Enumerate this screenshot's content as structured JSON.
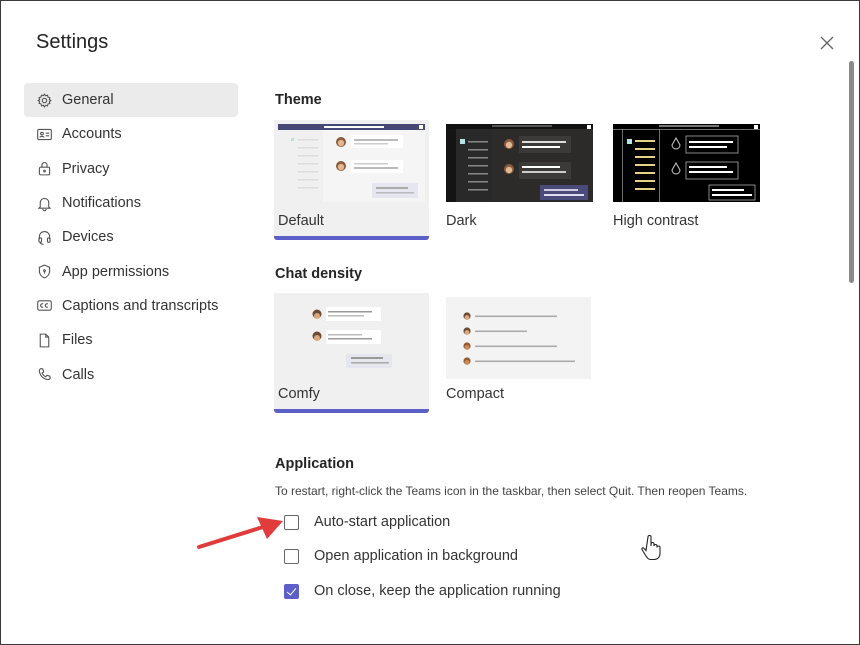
{
  "dialog": {
    "title": "Settings",
    "close_icon": "close-icon"
  },
  "sidebar": {
    "items": [
      {
        "label": "General",
        "icon": "gear-icon",
        "active": true
      },
      {
        "label": "Accounts",
        "icon": "contact-card-icon",
        "active": false
      },
      {
        "label": "Privacy",
        "icon": "lock-icon",
        "active": false
      },
      {
        "label": "Notifications",
        "icon": "bell-icon",
        "active": false
      },
      {
        "label": "Devices",
        "icon": "headset-icon",
        "active": false
      },
      {
        "label": "App permissions",
        "icon": "shield-icon",
        "active": false
      },
      {
        "label": "Captions and transcripts",
        "icon": "closed-captions-icon",
        "active": false
      },
      {
        "label": "Files",
        "icon": "file-icon",
        "active": false
      },
      {
        "label": "Calls",
        "icon": "phone-icon",
        "active": false
      }
    ]
  },
  "theme": {
    "heading": "Theme",
    "options": [
      {
        "label": "Default",
        "selected": true
      },
      {
        "label": "Dark",
        "selected": false
      },
      {
        "label": "High contrast",
        "selected": false
      }
    ]
  },
  "chat_density": {
    "heading": "Chat density",
    "options": [
      {
        "label": "Comfy",
        "selected": true
      },
      {
        "label": "Compact",
        "selected": false
      }
    ]
  },
  "application": {
    "heading": "Application",
    "description": "To restart, right-click the Teams icon in the taskbar, then select Quit. Then reopen Teams.",
    "options": [
      {
        "label": "Auto-start application",
        "checked": false
      },
      {
        "label": "Open application in background",
        "checked": false
      },
      {
        "label": "On close, keep the application running",
        "checked": true
      }
    ]
  },
  "colors": {
    "accent": "#5b5fc7",
    "annotation_arrow": "#e03c3c"
  }
}
